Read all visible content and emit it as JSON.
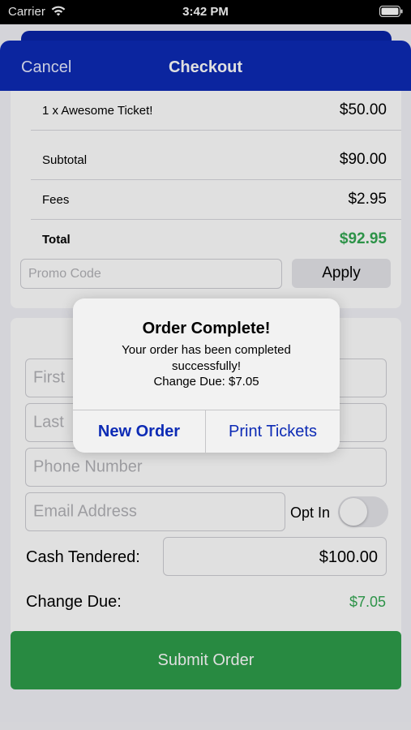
{
  "status_bar": {
    "carrier": "Carrier",
    "time": "3:42 PM"
  },
  "nav": {
    "cancel": "Cancel",
    "title": "Checkout"
  },
  "summary": {
    "rows": [
      {
        "label": "1 x Awesome Ticket!",
        "value": "$50.00"
      },
      {
        "label": "Subtotal",
        "value": "$90.00"
      },
      {
        "label": "Fees",
        "value": "$2.95"
      }
    ],
    "total": {
      "label": "Total",
      "value": "$92.95"
    },
    "promo_placeholder": "Promo Code",
    "apply_label": "Apply"
  },
  "customer": {
    "first_placeholder": "First",
    "last_placeholder": "Last",
    "phone_placeholder": "Phone Number",
    "email_placeholder": "Email Address",
    "opt_in_label": "Opt In",
    "opt_in_on": false,
    "cash_label": "Cash Tendered:",
    "cash_value": "$100.00",
    "change_label": "Change Due:",
    "change_value": "$7.05"
  },
  "submit_label": "Submit Order",
  "alert": {
    "title": "Order Complete!",
    "message_line1": "Your order has been completed",
    "message_line2": "successfully!",
    "message_line3": "Change Due: $7.05",
    "buttons": [
      "New Order",
      "Print Tickets"
    ]
  },
  "colors": {
    "nav_blue": "#0d2bb5",
    "success_green": "#34a853",
    "submit_green": "#2e9e4a"
  },
  "icons": [
    "wifi-icon",
    "battery-icon"
  ]
}
